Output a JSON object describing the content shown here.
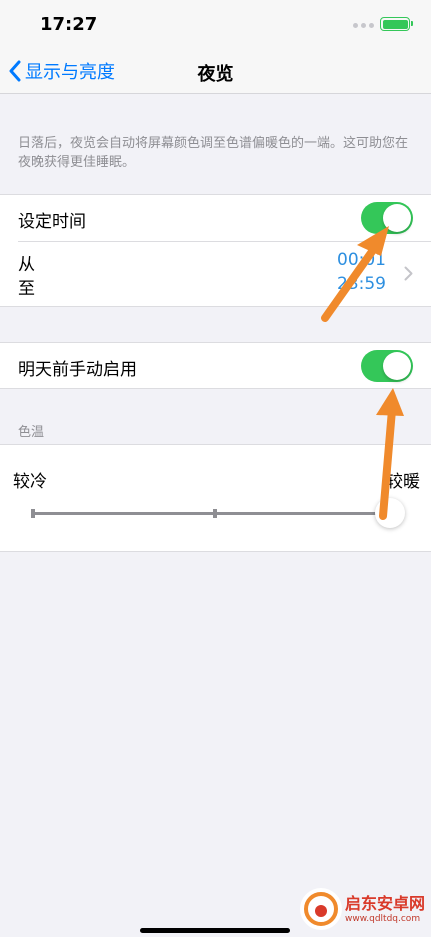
{
  "status_bar": {
    "time": "17:27"
  },
  "nav": {
    "back_label": "显示与亮度",
    "title": "夜览"
  },
  "description": "日落后，夜览会自动将屏幕颜色调至色谱偏暖色的一端。这可助您在夜晚获得更佳睡眠。",
  "schedule": {
    "label": "设定时间",
    "enabled": true,
    "from_label": "从",
    "to_label": "至",
    "from_time": "00:01",
    "to_time": "23:59"
  },
  "manual": {
    "label": "明天前手动启用",
    "enabled": true
  },
  "color_temp": {
    "header": "色温",
    "cooler_label": "较冷",
    "warmer_label": "较暖",
    "level": 1.0
  },
  "watermark": {
    "main": "启东安卓网",
    "sub": "www.qdltdq.com"
  },
  "colors": {
    "accent": "#007aff",
    "toggle_on": "#34c759",
    "annotation_arrow": "#f08a2c"
  }
}
